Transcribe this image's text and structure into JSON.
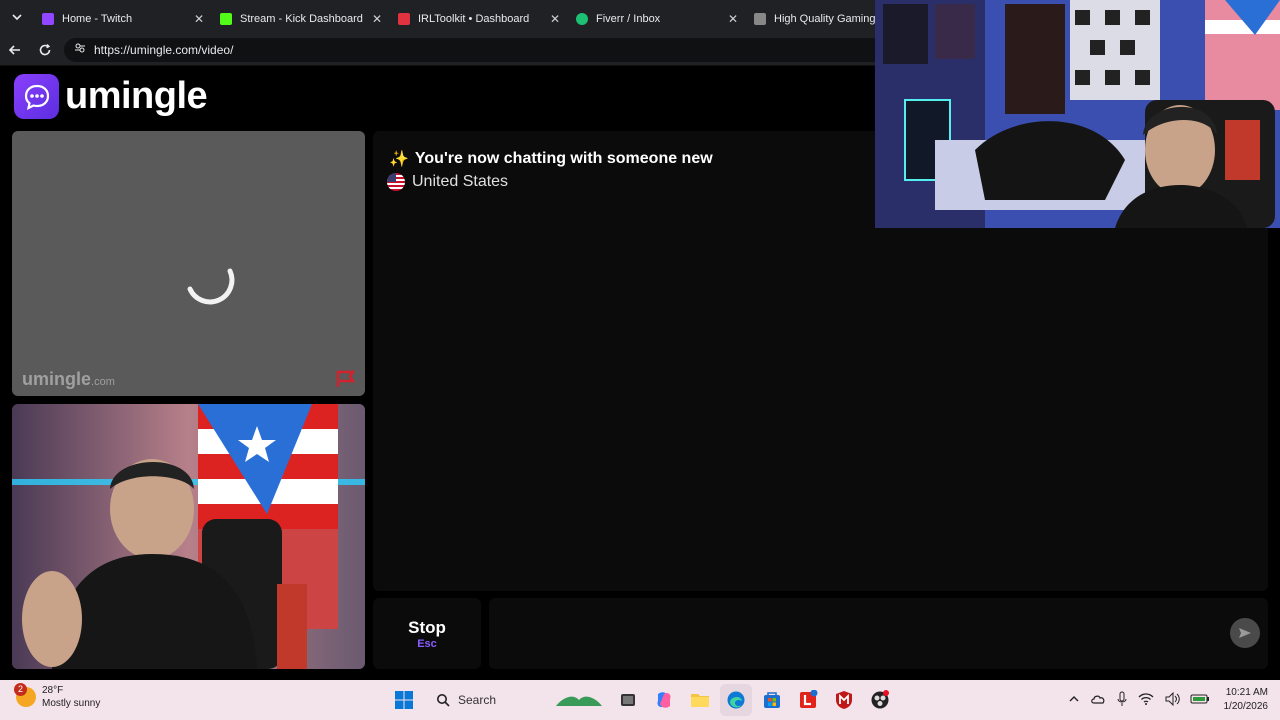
{
  "browser": {
    "tabs": [
      {
        "title": "Home - Twitch",
        "color": "#9146ff"
      },
      {
        "title": "Stream - Kick Dashboard",
        "color": "#53fc18"
      },
      {
        "title": "IRLToolkit • Dashboard",
        "color": "#e0333f"
      },
      {
        "title": "Fiverr / Inbox",
        "color": "#1dbf73"
      },
      {
        "title": "High Quality Gaming Ge",
        "color": "#888888"
      }
    ],
    "url": "https://umingle.com/video/"
  },
  "page": {
    "logo_text": "umingle",
    "watermark_main": "umingle",
    "watermark_suffix": ".com",
    "chat": {
      "status": "You're now chatting with someone new",
      "country": "United States"
    },
    "stop_label": "Stop",
    "stop_key": "Esc"
  },
  "taskbar": {
    "weather_badge": "2",
    "temperature": "28°F",
    "condition": "Mostly sunny",
    "search_label": "Search",
    "time": "10:21 AM",
    "date": "1/20/2026"
  },
  "colors": {
    "accent": "#7b3ff2",
    "taskbar": "#f3e3ea"
  }
}
